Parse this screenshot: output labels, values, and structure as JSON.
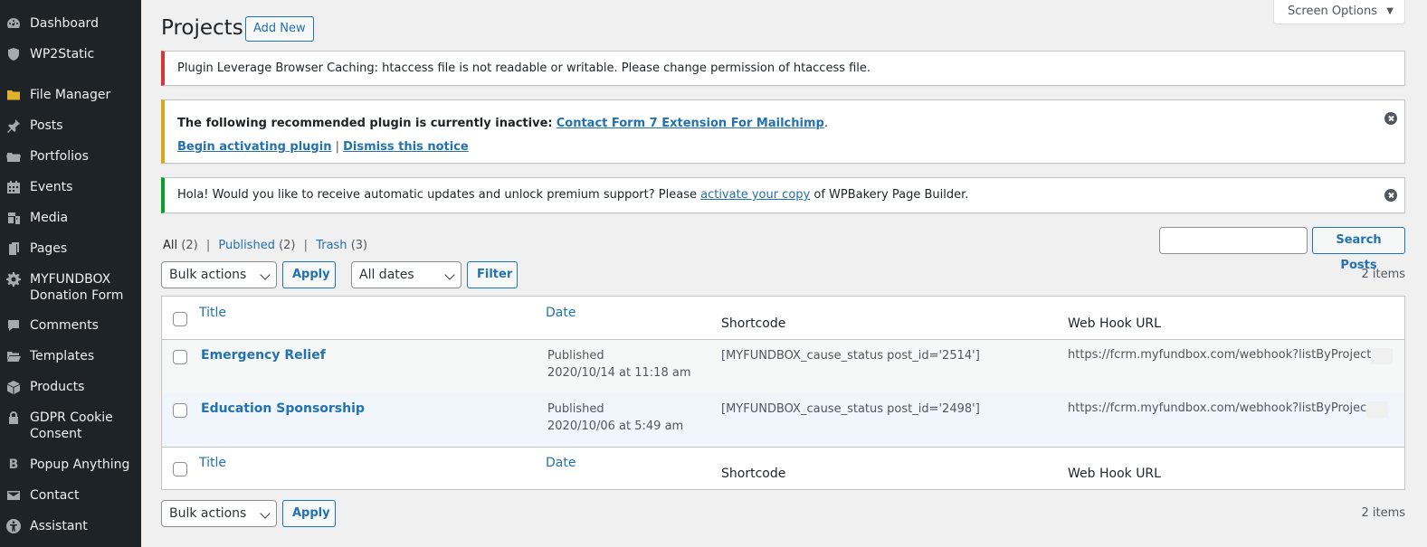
{
  "sidebar": {
    "items": [
      {
        "label": "Dashboard",
        "icon": "dashboard-icon"
      },
      {
        "label": "WP2Static",
        "icon": "shield-icon"
      },
      {
        "label": "File Manager",
        "icon": "folder-icon"
      },
      {
        "label": "Posts",
        "icon": "pushpin-icon"
      },
      {
        "label": "Portfolios",
        "icon": "portfolio-icon"
      },
      {
        "label": "Events",
        "icon": "calendar-icon"
      },
      {
        "label": "Media",
        "icon": "media-icon"
      },
      {
        "label": "Pages",
        "icon": "pages-icon"
      },
      {
        "label": "MYFUNDBOX Donation Form",
        "icon": "gear-icon"
      },
      {
        "label": "Comments",
        "icon": "comment-icon"
      },
      {
        "label": "Templates",
        "icon": "folder-open-icon"
      },
      {
        "label": "Products",
        "icon": "box-icon"
      },
      {
        "label": "GDPR Cookie Consent",
        "icon": "lock-icon"
      },
      {
        "label": "Popup Anything",
        "icon": "b-icon"
      },
      {
        "label": "Contact",
        "icon": "envelope-icon"
      },
      {
        "label": "Assistant",
        "icon": "accessibility-icon"
      }
    ]
  },
  "header": {
    "title": "Projects",
    "add_new": "Add New",
    "screen_options": "Screen Options"
  },
  "notices": {
    "error": {
      "text": "Plugin Leverage Browser Caching: htaccess file is not readable or writable. Please change permission of htaccess file."
    },
    "warning": {
      "prefix": "The following recommended plugin is currently inactive:",
      "link": "Contact Form 7 Extension For Mailchimp",
      "suffix": ".",
      "begin": "Begin activating plugin",
      "sep": "|",
      "dismiss": "Dismiss this notice"
    },
    "success": {
      "prefix": "Hola! Would you like to receive automatic updates and unlock premium support? Please",
      "link": "activate your copy",
      "suffix": "of WPBakery Page Builder."
    }
  },
  "views": {
    "all": "All",
    "all_count": "(2)",
    "published": "Published",
    "published_count": "(2)",
    "trash": "Trash",
    "trash_count": "(3)",
    "sep": "|"
  },
  "search": {
    "button": "Search Posts",
    "value": ""
  },
  "filters": {
    "bulk_actions": "Bulk actions",
    "apply": "Apply",
    "dates": "All dates",
    "filter": "Filter",
    "count": "2 items"
  },
  "table": {
    "columns": {
      "title": "Title",
      "date": "Date",
      "shortcode": "Shortcode",
      "webhook": "Web Hook URL"
    },
    "rows": [
      {
        "title": "Emergency Relief",
        "status": "Published",
        "date": "2020/10/14 at 11:18 am",
        "shortcode": "[MYFUNDBOX_cause_status post_id='2514']",
        "webhook": "https://fcrm.myfundbox.com/webhook?listByProjectId="
      },
      {
        "title": "Education Sponsorship",
        "status": "Published",
        "date": "2020/10/06 at 5:49 am",
        "shortcode": "[MYFUNDBOX_cause_status post_id='2498']",
        "webhook": "https://fcrm.myfundbox.com/webhook?listByProjectId="
      }
    ]
  },
  "colors": {
    "sidebar_bg": "#1d2327",
    "link": "#2271b1",
    "error": "#d63638",
    "warning": "#dba617",
    "success": "#00a32a"
  }
}
